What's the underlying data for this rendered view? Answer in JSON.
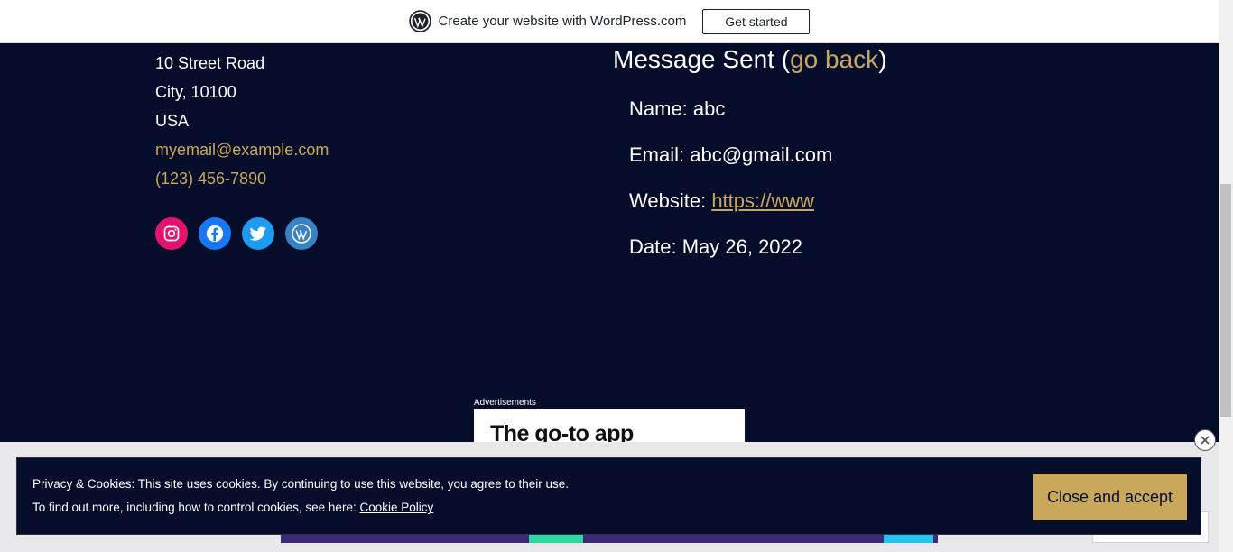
{
  "wpbar": {
    "text": "Create your website with WordPress.com",
    "button": "Get started",
    "logo_icon": "wordpress-logo-icon"
  },
  "address": {
    "street": "10 Street Road",
    "city": "City, 10100",
    "country": "USA",
    "email": "myemail@example.com",
    "phone": "(123) 456-7890"
  },
  "social": [
    {
      "name": "instagram-icon",
      "color": "#e4136f"
    },
    {
      "name": "facebook-icon",
      "color": "#1877f2"
    },
    {
      "name": "twitter-icon",
      "color": "#1d9bf0"
    },
    {
      "name": "wordpress-icon",
      "color": "#3582c4"
    }
  ],
  "message": {
    "title_prefix": "Message Sent (",
    "go_back": "go back",
    "title_suffix": ")",
    "name_label": "Name: abc",
    "email_label": "Email: abc@gmail.com",
    "website_prefix": "Website: ",
    "website_link": "https://www",
    "date_label": "Date: May 26, 2022"
  },
  "ad": {
    "label": "Advertisements",
    "headline": "The go-to app"
  },
  "cookie": {
    "line1": "Privacy & Cookies: This site uses cookies. By continuing to use this website, you agree to their use.",
    "line2_prefix": "To find out more, including how to control cookies, see here: ",
    "policy_link": "Cookie Policy",
    "accept_button": "Close and accept"
  },
  "colors": {
    "background": "#050d2b",
    "accent": "#c9a85c"
  }
}
